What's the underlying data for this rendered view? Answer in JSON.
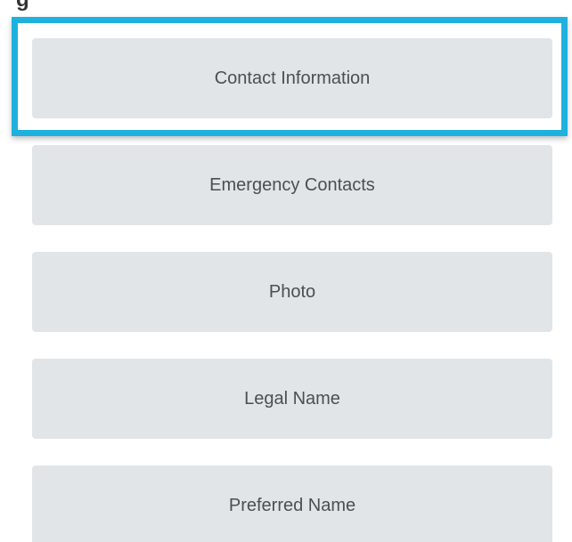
{
  "heading_fragment": "g",
  "buttons": [
    {
      "label": "Contact Information"
    },
    {
      "label": "Emergency Contacts"
    },
    {
      "label": "Photo"
    },
    {
      "label": "Legal Name"
    },
    {
      "label": "Preferred Name"
    }
  ],
  "colors": {
    "button_bg": "#e1e5e8",
    "button_text": "#4b4f54",
    "highlight": "#1fb1de"
  }
}
